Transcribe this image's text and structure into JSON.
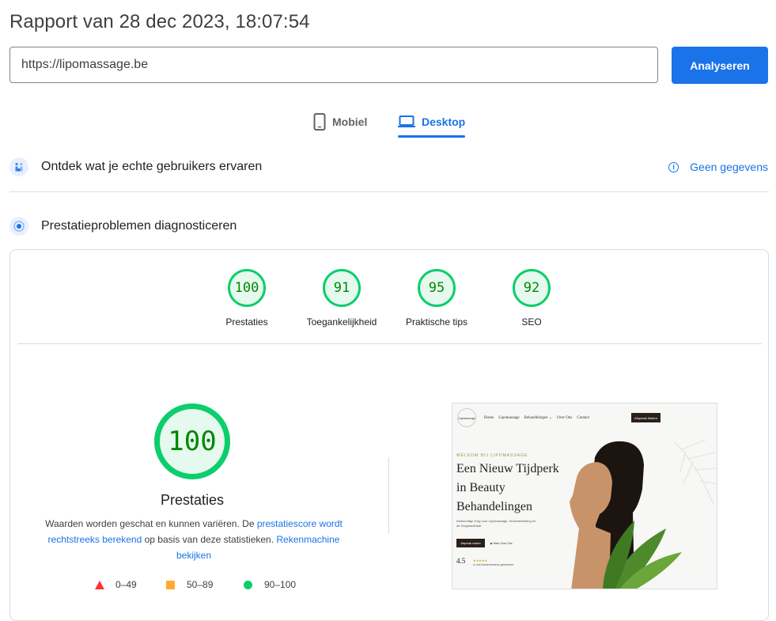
{
  "header": {
    "title": "Rapport van 28 dec 2023, 18:07:54"
  },
  "url_input": {
    "value": "https://lipomassage.be"
  },
  "analyze_button": {
    "label": "Analyseren"
  },
  "device_tabs": [
    {
      "label": "Mobiel",
      "icon": "phone-icon",
      "selected": false
    },
    {
      "label": "Desktop",
      "icon": "laptop-icon",
      "selected": true
    }
  ],
  "field_data": {
    "title": "Ontdek wat je echte gebruikers ervaren",
    "status": "Geen gegevens",
    "status_icon": "info-icon"
  },
  "lab_data": {
    "title": "Prestatieproblemen diagnosticeren"
  },
  "scores": [
    {
      "label": "Prestaties",
      "value": 100
    },
    {
      "label": "Toegankelijkheid",
      "value": 91
    },
    {
      "label": "Praktische tips",
      "value": 95
    },
    {
      "label": "SEO",
      "value": 92
    }
  ],
  "performance": {
    "score": 100,
    "label": "Prestaties",
    "desc_1": "Waarden worden geschat en kunnen variëren. De ",
    "link_1": "prestatiescore wordt rechtstreeks berekend",
    "desc_2": " op basis van deze statistieken. ",
    "link_2": "Rekenmachine bekijken"
  },
  "legend": [
    {
      "range": "0–49",
      "shape": "triangle",
      "color": "#ff3333"
    },
    {
      "range": "50–89",
      "shape": "square",
      "color": "#ffaa33"
    },
    {
      "range": "90–100",
      "shape": "circle",
      "color": "#0cce6b"
    }
  ],
  "screenshot": {
    "logo": "Lipomassage",
    "nav": [
      "Home",
      "Lipomassage",
      "Behandelingen ⌄",
      "Over Ons",
      "Contact"
    ],
    "cta": "Afspraak Maken",
    "kicker": "WELKOM BIJ LIPOMASSAGE",
    "headline": "Een Nieuw Tijdperk in Beauty Behandelingen",
    "sub": "Deskundige Zorg voor Lipomassage, Huidverbetering en de Zorgkandidaat",
    "btn1": "Afspraak maken",
    "btn2": "▶ Meer Over Ons",
    "rating": "4.5",
    "stars": "★★★★★",
    "rating_text": "In ons klantenreviews gesorteerd"
  },
  "colors": {
    "accent": "#1a73e8",
    "pass": "#0cce6b",
    "pass_text": "#008800"
  }
}
